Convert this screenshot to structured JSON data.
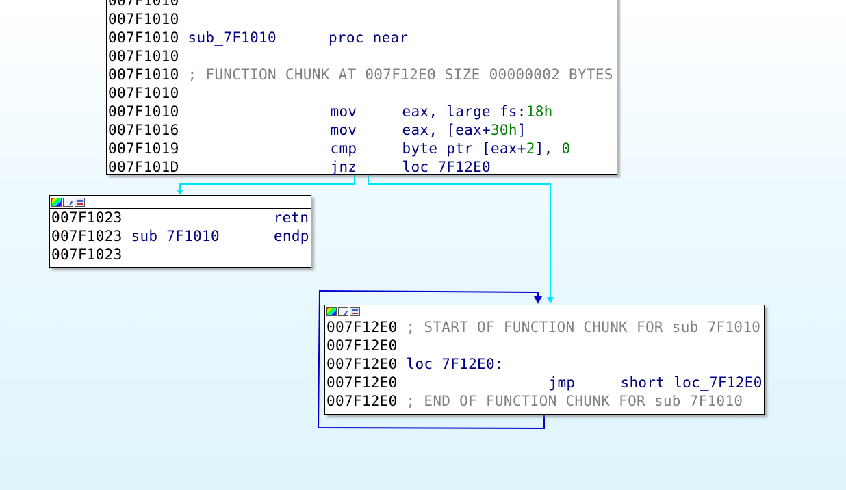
{
  "nodes": {
    "main": {
      "lines": [
        {
          "addr": "007F1010",
          "name": "",
          "mnem": "",
          "ops": ""
        },
        {
          "addr": "007F1010",
          "name": "",
          "mnem": "",
          "ops": ""
        },
        {
          "addr": "007F1010",
          "name": "sub_7F1010",
          "mnem": "proc near",
          "ops": ""
        },
        {
          "addr": "007F1010",
          "name": "",
          "mnem": "",
          "ops": ""
        },
        {
          "addr": "007F1010",
          "comment": "; FUNCTION CHUNK AT 007F12E0 SIZE 00000002 BYTES"
        },
        {
          "addr": "007F1010",
          "name": "",
          "mnem": "",
          "ops": ""
        },
        {
          "addr": "007F1010",
          "mnem": "mov",
          "op1": "eax, large fs:",
          "num1": "18h",
          "op2": ""
        },
        {
          "addr": "007F1016",
          "mnem": "mov",
          "op1": "eax, [eax+",
          "num1": "30h",
          "op2": "]"
        },
        {
          "addr": "007F1019",
          "mnem": "cmp",
          "op1": "byte ptr [eax+",
          "num1": "2",
          "op2": "], ",
          "num2": "0"
        },
        {
          "addr": "007F101D",
          "mnem": "jnz",
          "op1": "loc_7F12E0",
          "num1": "",
          "op2": ""
        }
      ]
    },
    "ret": {
      "lines": [
        {
          "addr": "007F1023",
          "name": "",
          "mnem": "retn"
        },
        {
          "addr": "007F1023",
          "name": "sub_7F1010",
          "mnem": "endp"
        },
        {
          "addr": "007F1023",
          "name": "",
          "mnem": ""
        }
      ]
    },
    "chunk": {
      "lines": [
        {
          "addr": "007F12E0",
          "comment": "; START OF FUNCTION CHUNK FOR sub_7F1010"
        },
        {
          "addr": "007F12E0",
          "comment": ""
        },
        {
          "addr": "007F12E0",
          "label": "loc_7F12E0:"
        },
        {
          "addr": "007F12E0",
          "mnem": "jmp",
          "ops": "short loc_7F12E0"
        },
        {
          "addr": "007F12E0",
          "comment": "; END OF FUNCTION CHUNK FOR sub_7F1010"
        }
      ]
    }
  },
  "colors": {
    "edge_conditional": "#00e5ff",
    "edge_loop": "#0000d0",
    "address": "#000000",
    "name": "#000080",
    "number": "#008000",
    "comment": "#808080"
  },
  "icons": [
    "color-palette-icon",
    "rename-icon",
    "graph-view-icon"
  ]
}
